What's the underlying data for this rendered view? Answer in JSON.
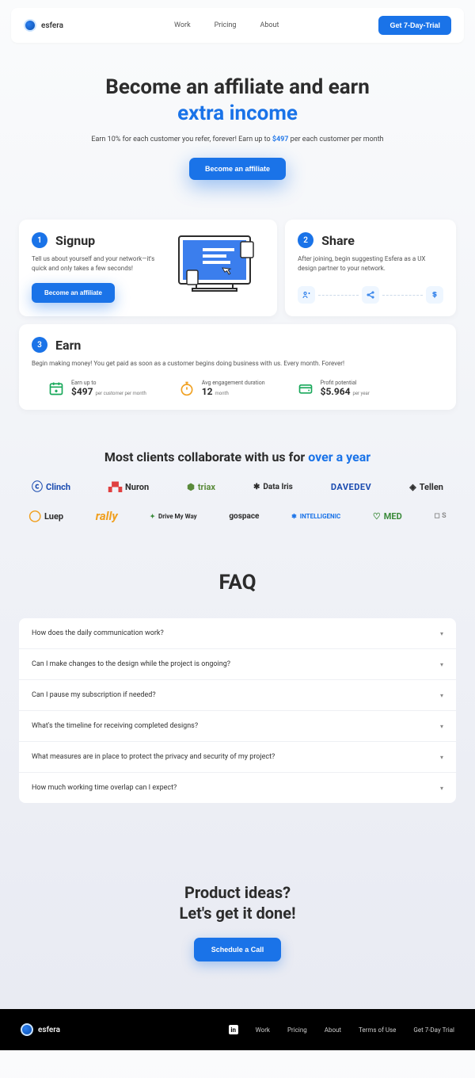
{
  "header": {
    "logo_text": "esfera",
    "nav": [
      "Work",
      "Pricing",
      "About"
    ],
    "cta": "Get 7-Day-Trial"
  },
  "hero": {
    "title_line1": "Become an affiliate and earn",
    "title_line2": "extra income",
    "sub_pre": "Earn 10% for each customer you refer, forever! Earn up to ",
    "sub_price": "$497",
    "sub_post": " per each customer per month",
    "cta": "Become an affiliate"
  },
  "steps": {
    "step1": {
      "num": "1",
      "title": "Signup",
      "desc": "Tell us about yourself and your network—it's quick and only takes a few seconds!",
      "cta": "Become an affiliate"
    },
    "step2": {
      "num": "2",
      "title": "Share",
      "desc": "After joining, begin suggesting Esfera as a UX design partner to your network."
    },
    "step3": {
      "num": "3",
      "title": "Earn",
      "desc": "Begin making money! You get paid as soon as a customer begins doing business with us. Every month. Forever!",
      "stats": [
        {
          "label": "Earn up to",
          "value": "$497",
          "suffix": "per customer per month"
        },
        {
          "label": "Avg engagement duration",
          "value": "12",
          "suffix": "month"
        },
        {
          "label": "Profit potential",
          "value": "$5.964",
          "suffix": "per year"
        }
      ]
    }
  },
  "clients": {
    "title_pre": "Most clients collaborate with us for ",
    "title_accent": "over a year",
    "row1": [
      "Clinch",
      "Nuron",
      "triax",
      "Data Iris",
      "DAVEDEV",
      "Tellen"
    ],
    "row2": [
      "Luep",
      "rally",
      "Drive My Way",
      "gospace",
      "INTELLIGENIC",
      "MED"
    ]
  },
  "faq": {
    "title": "FAQ",
    "items": [
      "How does the daily communication work?",
      "Can I make changes to the design while the project is ongoing?",
      "Can I pause my subscription if needed?",
      "What's the timeline for receiving completed designs?",
      "What measures are in place to protect the privacy and security of my project?",
      "How much working time overlap can I expect?"
    ]
  },
  "cta": {
    "line1": "Product ideas?",
    "line2": "Let's get it done!",
    "button": "Schedule a Call"
  },
  "footer": {
    "logo_text": "esfera",
    "links": [
      "Work",
      "Pricing",
      "About",
      "Terms of Use",
      "Get 7-Day Trial"
    ]
  }
}
